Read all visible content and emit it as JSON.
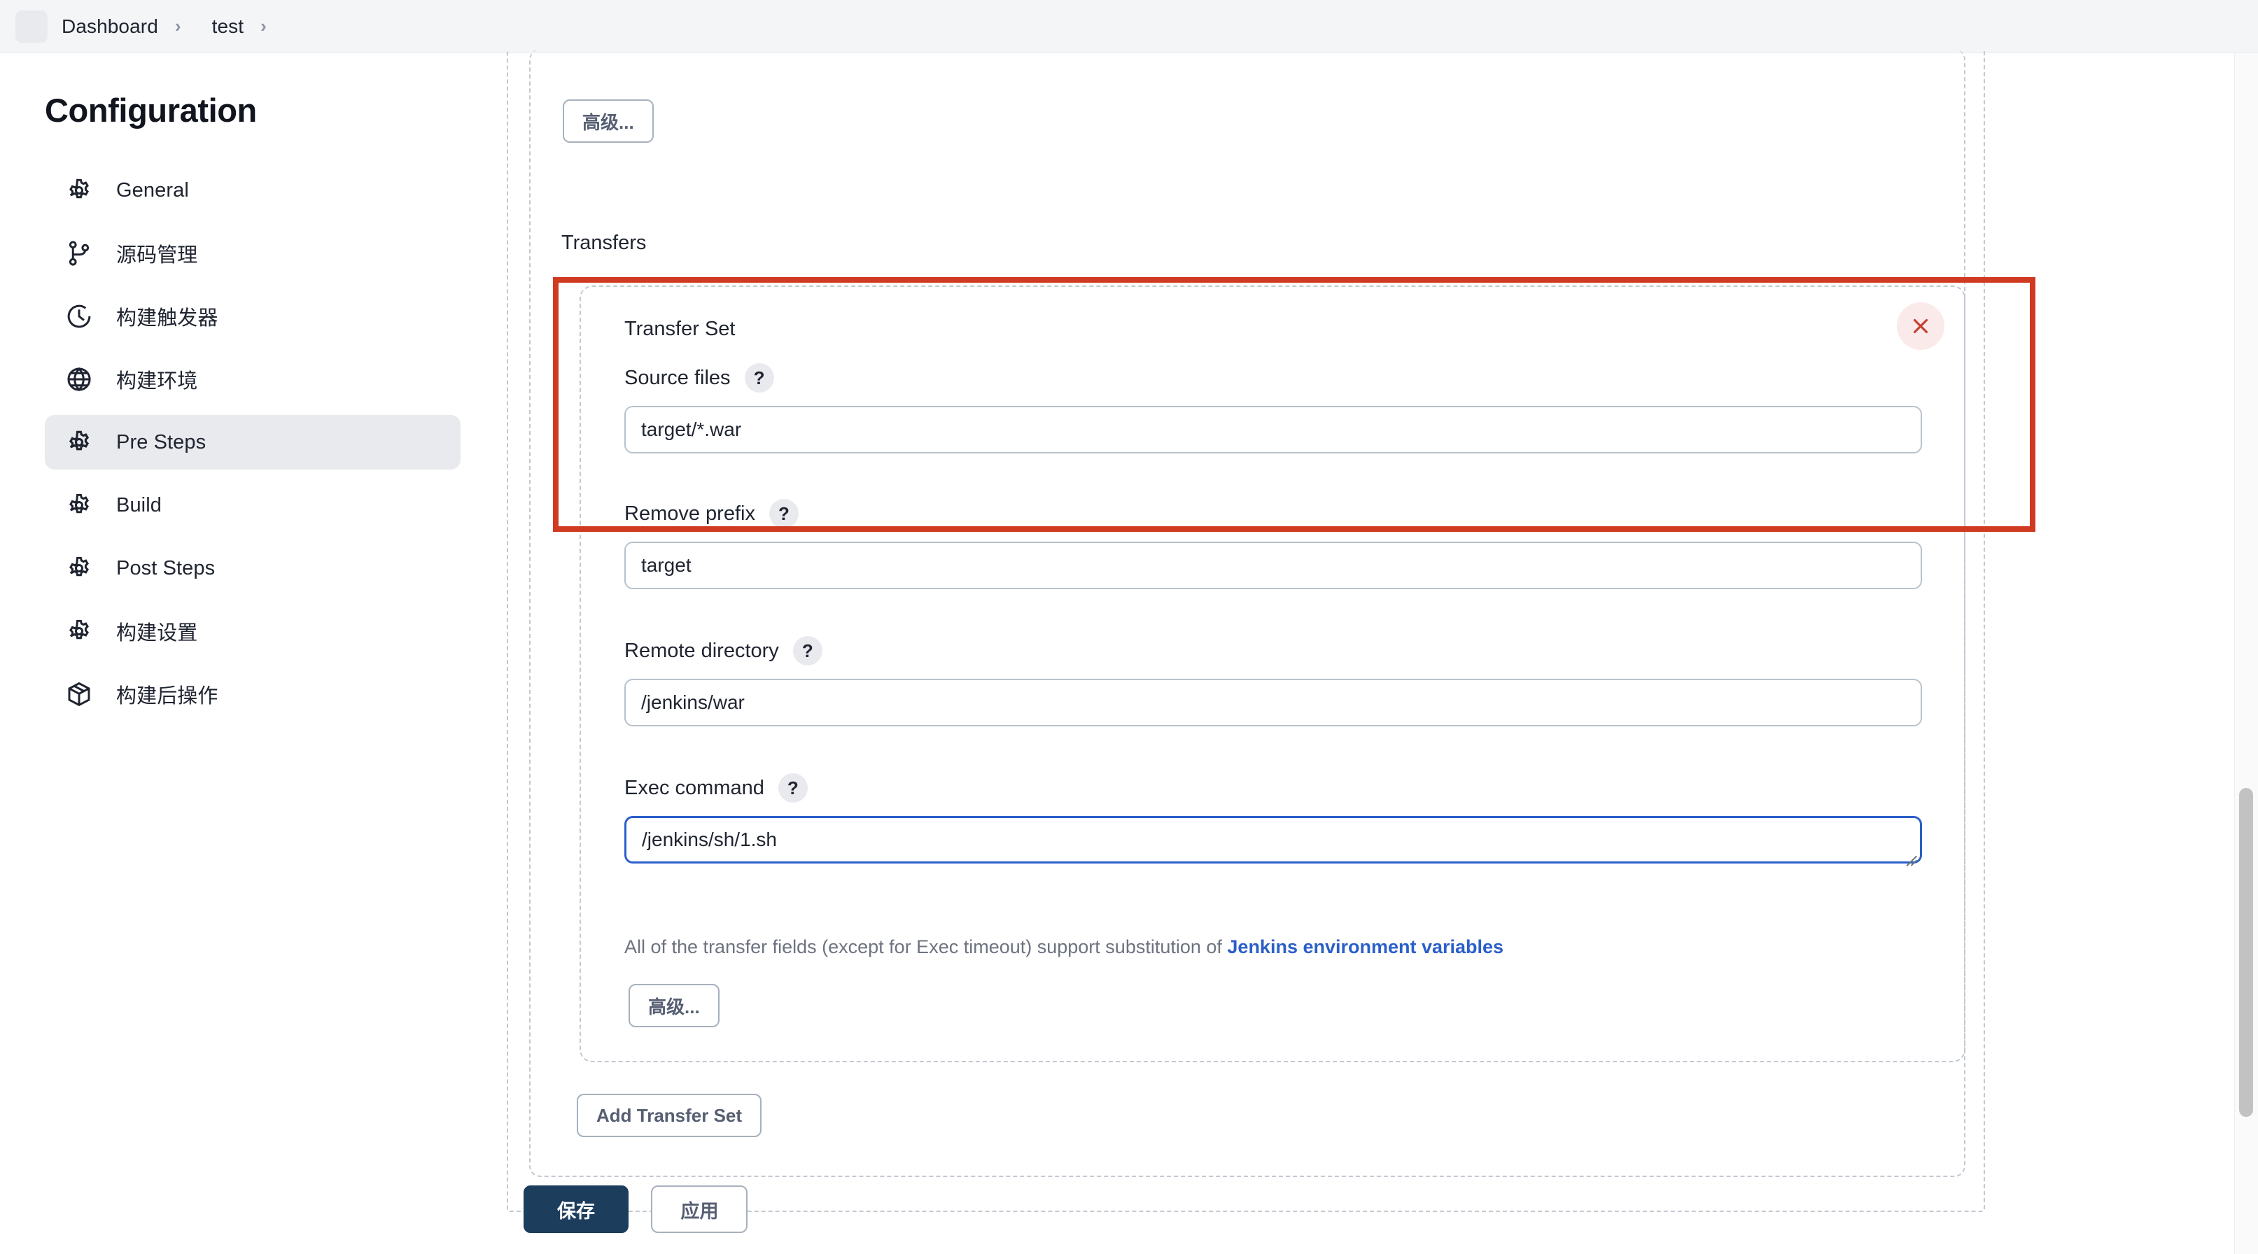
{
  "breadcrumb": {
    "logo_icon": "app-logo-placeholder",
    "items": [
      {
        "label": "Dashboard"
      },
      {
        "label": "test"
      }
    ],
    "separator": "›"
  },
  "sidebar": {
    "title": "Configuration",
    "items": [
      {
        "label": "General",
        "icon": "gear-icon",
        "active": false
      },
      {
        "label": "源码管理",
        "icon": "branch-icon",
        "active": false
      },
      {
        "label": "构建触发器",
        "icon": "clock-icon",
        "active": false
      },
      {
        "label": "构建环境",
        "icon": "globe-icon",
        "active": false
      },
      {
        "label": "Pre Steps",
        "icon": "gear-icon",
        "active": true
      },
      {
        "label": "Build",
        "icon": "gear-icon",
        "active": false
      },
      {
        "label": "Post Steps",
        "icon": "gear-icon",
        "active": false
      },
      {
        "label": "构建设置",
        "icon": "gear-icon",
        "active": false
      },
      {
        "label": "构建后操作",
        "icon": "box-icon",
        "active": false
      }
    ]
  },
  "main": {
    "advanced_top_label": "高级...",
    "transfers_label": "Transfers",
    "transfer_set": {
      "title": "Transfer Set",
      "close_icon": "close-icon",
      "help_icon_glyph": "?",
      "fields": [
        {
          "label": "Source files",
          "value": "target/*.war",
          "focused": false
        },
        {
          "label": "Remove prefix",
          "value": "target",
          "focused": false
        },
        {
          "label": "Remote directory",
          "value": "/jenkins/war",
          "focused": false
        },
        {
          "label": "Exec command",
          "value": "/jenkins/sh/1.sh",
          "focused": true
        }
      ],
      "help_note_prefix": "All of the transfer fields (except for Exec timeout) support substitution of ",
      "help_note_link": "Jenkins environment variables",
      "advanced_label": "高级..."
    },
    "add_transfer_set_label": "Add Transfer Set"
  },
  "footer": {
    "save_label": "保存",
    "apply_label": "应用"
  },
  "colors": {
    "accent_red": "#cf3a21",
    "link_blue": "#2b5fc9",
    "focus_blue": "#2b5fc9",
    "primary_button": "#1c3d5c",
    "close_red": "#c5412f"
  }
}
